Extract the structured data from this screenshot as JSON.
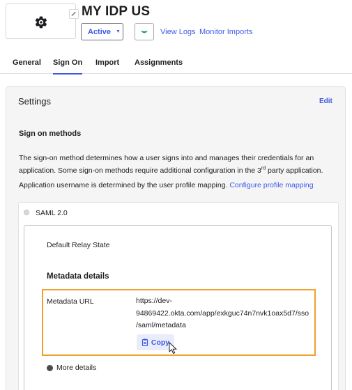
{
  "header": {
    "app_name": "MY IDP US",
    "status_label": "Active",
    "links": {
      "view_logs": "View Logs",
      "monitor_imports": "Monitor Imports"
    },
    "icons": {
      "logo": "gear-icon",
      "edit_logo": "pencil-icon",
      "status_caret": "caret-down-icon",
      "push": "push-status-icon"
    }
  },
  "tabs": [
    {
      "label": "General",
      "active": false
    },
    {
      "label": "Sign On",
      "active": true
    },
    {
      "label": "Import",
      "active": false
    },
    {
      "label": "Assignments",
      "active": false
    }
  ],
  "settings": {
    "title": "Settings",
    "edit_label": "Edit",
    "section_title": "Sign on methods",
    "description_1": "The sign-on method determines how a user signs into and manages their credentials for an application. Some sign-on methods require additional configuration in the 3",
    "description_sup": "rd",
    "description_2": " party application.",
    "username_text": "Application username is determined by the user profile mapping.",
    "username_link": "Configure profile mapping"
  },
  "saml": {
    "method_label": "SAML 2.0",
    "relay_state_label": "Default Relay State",
    "metadata_title": "Metadata details",
    "metadata_url_label": "Metadata URL",
    "metadata_url_value": "https://dev-94869422.okta.com/app/exkguc74n7nvk1oax5d7/sso/saml/metadata",
    "copy_label": "Copy",
    "more_details_label": "More details"
  },
  "colors": {
    "accent": "#3f59e4",
    "highlight": "#f0a02d",
    "push_green": "#1a9a5b"
  }
}
